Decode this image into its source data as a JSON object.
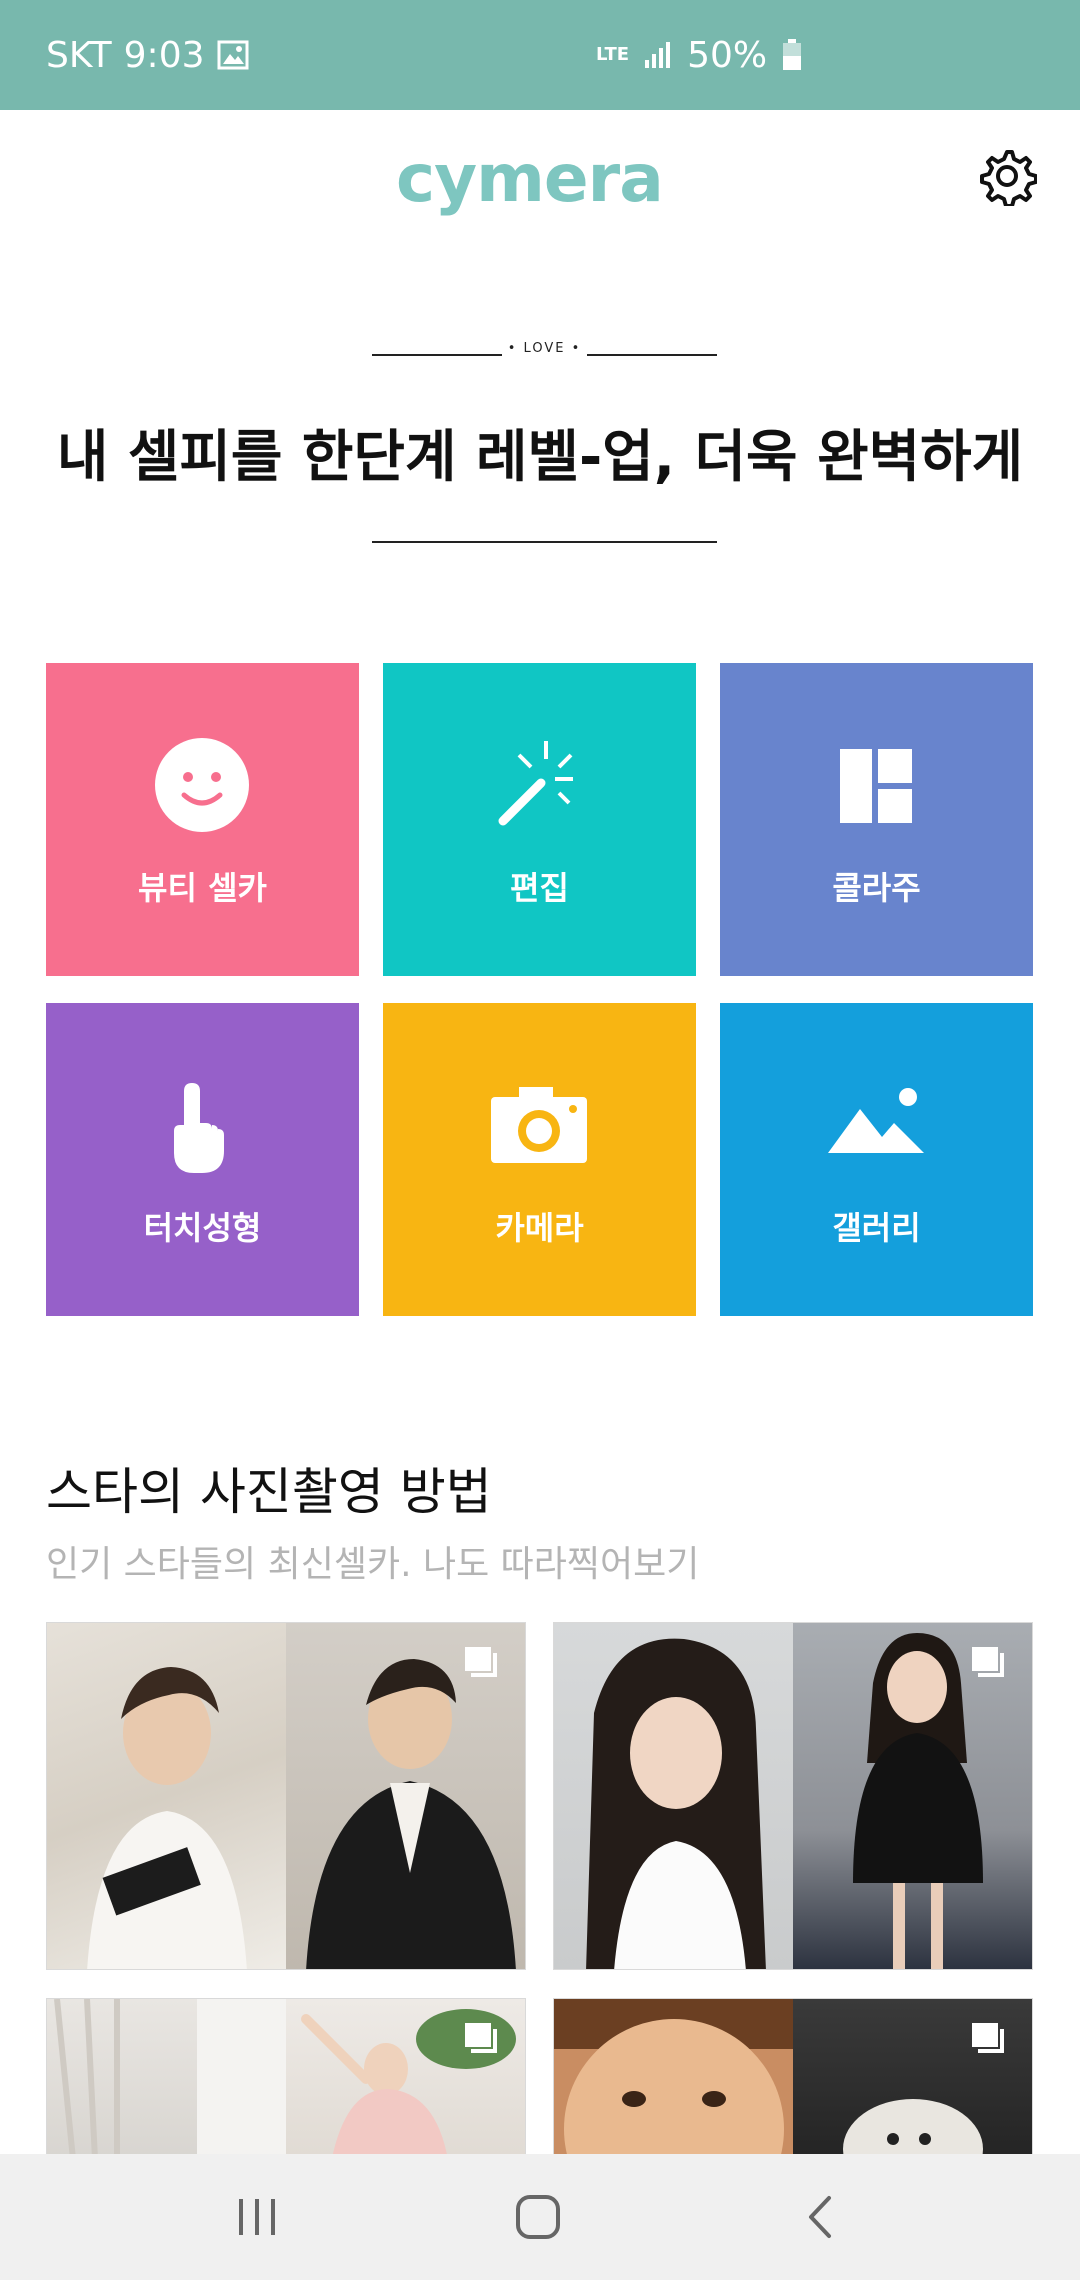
{
  "status": {
    "carrier": "SKT",
    "time": "9:03",
    "network": "LTE",
    "battery": "50%"
  },
  "header": {
    "logo": "cymera",
    "settings_icon": "gear-icon"
  },
  "hero": {
    "small_label": "• LOVE •",
    "headline": "내 셀피를 한단계 레벨-업, 더욱 완벽하게"
  },
  "features": [
    {
      "label": "뷰티 셀카",
      "icon": "smiley-face-icon",
      "color": "#f76f8e"
    },
    {
      "label": "편집",
      "icon": "magic-wand-icon",
      "color": "#10c6c4"
    },
    {
      "label": "콜라주",
      "icon": "collage-layout-icon",
      "color": "#6884cd"
    },
    {
      "label": "터치성형",
      "icon": "pointing-hand-icon",
      "color": "#9660c9"
    },
    {
      "label": "카메라",
      "icon": "camera-icon",
      "color": "#f8b512"
    },
    {
      "label": "갤러리",
      "icon": "mountain-landscape-icon",
      "color": "#149fdc"
    }
  ],
  "stars_section": {
    "title": "스타의 사진촬영 방법",
    "subtitle": "인기 스타들의 최신셀카. 나도 따라찍어보기"
  },
  "colors": {
    "status_bar": "#78b8ad",
    "brand": "#7ec6c0"
  },
  "nav": {
    "recents_icon": "recent-apps-icon",
    "home_icon": "home-icon",
    "back_icon": "back-icon"
  }
}
